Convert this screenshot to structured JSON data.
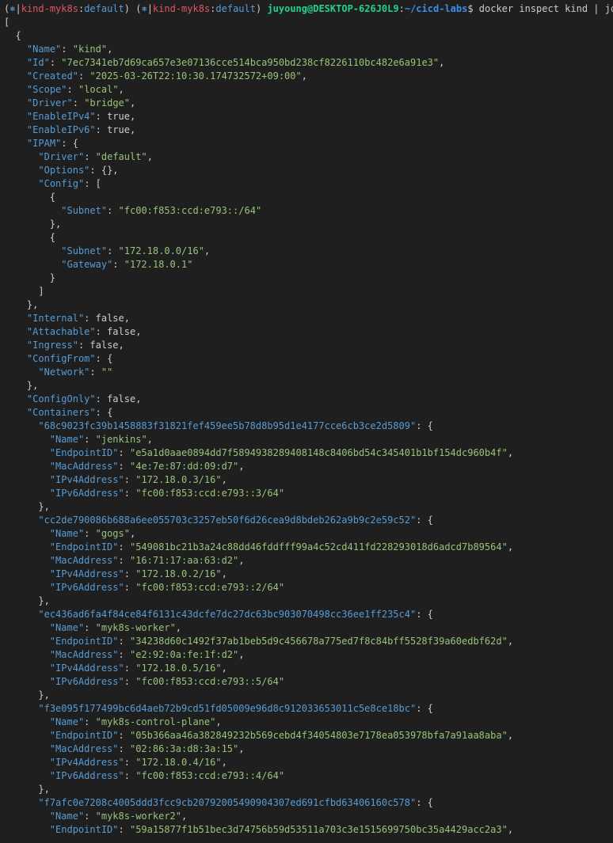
{
  "prompt": {
    "context_symbol": "⎈",
    "context_name": "kind-myk8s",
    "context_namespace": "default",
    "user_host": "juyoung@DESKTOP-626J0L9",
    "path": "~/cicd-labs",
    "command": "docker inspect kind | jq"
  },
  "output": [
    {
      "indent": 0,
      "text": "["
    },
    {
      "indent": 1,
      "text": "{"
    },
    {
      "indent": 2,
      "key": "Name",
      "str": "kind",
      "tail": ","
    },
    {
      "indent": 2,
      "key": "Id",
      "str": "7ec7341eb7d69ca657e3e07136cce514bca950bd238cf8226110bc482e6a91e3",
      "tail": ","
    },
    {
      "indent": 2,
      "key": "Created",
      "str": "2025-03-26T22:10:30.174732572+09:00",
      "tail": ","
    },
    {
      "indent": 2,
      "key": "Scope",
      "str": "local",
      "tail": ","
    },
    {
      "indent": 2,
      "key": "Driver",
      "str": "bridge",
      "tail": ","
    },
    {
      "indent": 2,
      "key": "EnableIPv4",
      "val": "true",
      "tail": ","
    },
    {
      "indent": 2,
      "key": "EnableIPv6",
      "val": "true",
      "tail": ","
    },
    {
      "indent": 2,
      "key": "IPAM",
      "val": "{"
    },
    {
      "indent": 3,
      "key": "Driver",
      "str": "default",
      "tail": ","
    },
    {
      "indent": 3,
      "key": "Options",
      "val": "{},"
    },
    {
      "indent": 3,
      "key": "Config",
      "val": "["
    },
    {
      "indent": 4,
      "text": "{"
    },
    {
      "indent": 5,
      "key": "Subnet",
      "str": "fc00:f853:ccd:e793::/64"
    },
    {
      "indent": 4,
      "text": "},"
    },
    {
      "indent": 4,
      "text": "{"
    },
    {
      "indent": 5,
      "key": "Subnet",
      "str": "172.18.0.0/16",
      "tail": ","
    },
    {
      "indent": 5,
      "key": "Gateway",
      "str": "172.18.0.1"
    },
    {
      "indent": 4,
      "text": "}"
    },
    {
      "indent": 3,
      "text": "]"
    },
    {
      "indent": 2,
      "text": "},"
    },
    {
      "indent": 2,
      "key": "Internal",
      "val": "false",
      "tail": ","
    },
    {
      "indent": 2,
      "key": "Attachable",
      "val": "false",
      "tail": ","
    },
    {
      "indent": 2,
      "key": "Ingress",
      "val": "false",
      "tail": ","
    },
    {
      "indent": 2,
      "key": "ConfigFrom",
      "val": "{"
    },
    {
      "indent": 3,
      "key": "Network",
      "str": ""
    },
    {
      "indent": 2,
      "text": "},"
    },
    {
      "indent": 2,
      "key": "ConfigOnly",
      "val": "false",
      "tail": ","
    },
    {
      "indent": 2,
      "key": "Containers",
      "val": "{"
    },
    {
      "indent": 3,
      "key": "68c9023fc39b1458883f31821fef459ee5b78d8b95d1e4177cce6cb3ce2d5809",
      "val": "{"
    },
    {
      "indent": 4,
      "key": "Name",
      "str": "jenkins",
      "tail": ","
    },
    {
      "indent": 4,
      "key": "EndpointID",
      "str": "e5a1d0aae0894dd7f5894938289408148c8406bd54c345401b1bf154dc960b4f",
      "tail": ","
    },
    {
      "indent": 4,
      "key": "MacAddress",
      "str": "4e:7e:87:dd:09:d7",
      "tail": ","
    },
    {
      "indent": 4,
      "key": "IPv4Address",
      "str": "172.18.0.3/16",
      "tail": ","
    },
    {
      "indent": 4,
      "key": "IPv6Address",
      "str": "fc00:f853:ccd:e793::3/64"
    },
    {
      "indent": 3,
      "text": "},"
    },
    {
      "indent": 3,
      "key": "cc2de790086b688a6ee055703c3257eb50f6d26cea9d8bdeb262a9b9c2e59c52",
      "val": "{"
    },
    {
      "indent": 4,
      "key": "Name",
      "str": "gogs",
      "tail": ","
    },
    {
      "indent": 4,
      "key": "EndpointID",
      "str": "549081bc21b3a24c88dd46fddfff99a4c52cd411fd228293018d6adcd7b89564",
      "tail": ","
    },
    {
      "indent": 4,
      "key": "MacAddress",
      "str": "16:71:17:aa:63:d2",
      "tail": ","
    },
    {
      "indent": 4,
      "key": "IPv4Address",
      "str": "172.18.0.2/16",
      "tail": ","
    },
    {
      "indent": 4,
      "key": "IPv6Address",
      "str": "fc00:f853:ccd:e793::2/64"
    },
    {
      "indent": 3,
      "text": "},"
    },
    {
      "indent": 3,
      "key": "ec436ad6fa4f84ce84f6131c43dcfe7dc27dc63bc903070498cc36ee1ff235c4",
      "val": "{"
    },
    {
      "indent": 4,
      "key": "Name",
      "str": "myk8s-worker",
      "tail": ","
    },
    {
      "indent": 4,
      "key": "EndpointID",
      "str": "34238d60c1492f37ab1beb5d9c456678a775ed7f8c84bff5528f39a60edbf62d",
      "tail": ","
    },
    {
      "indent": 4,
      "key": "MacAddress",
      "str": "e2:92:0a:fe:1f:d2",
      "tail": ","
    },
    {
      "indent": 4,
      "key": "IPv4Address",
      "str": "172.18.0.5/16",
      "tail": ","
    },
    {
      "indent": 4,
      "key": "IPv6Address",
      "str": "fc00:f853:ccd:e793::5/64"
    },
    {
      "indent": 3,
      "text": "},"
    },
    {
      "indent": 3,
      "key": "f3e095f177499bc6d4aeb72b9cd51fd05009e96d8c912033653011c5e8ce18bc",
      "val": "{"
    },
    {
      "indent": 4,
      "key": "Name",
      "str": "myk8s-control-plane",
      "tail": ","
    },
    {
      "indent": 4,
      "key": "EndpointID",
      "str": "05b366aa46a382849232b569cebd4f34054803e7178ea053978bfa7a91aa8aba",
      "tail": ","
    },
    {
      "indent": 4,
      "key": "MacAddress",
      "str": "02:86:3a:d8:3a:15",
      "tail": ","
    },
    {
      "indent": 4,
      "key": "IPv4Address",
      "str": "172.18.0.4/16",
      "tail": ","
    },
    {
      "indent": 4,
      "key": "IPv6Address",
      "str": "fc00:f853:ccd:e793::4/64"
    },
    {
      "indent": 3,
      "text": "},"
    },
    {
      "indent": 3,
      "key": "f7afc0e7208c4005ddd3fcc9cb20792005490904307ed691cfbd63406160c578",
      "val": "{"
    },
    {
      "indent": 4,
      "key": "Name",
      "str": "myk8s-worker2",
      "tail": ","
    },
    {
      "indent": 4,
      "key": "EndpointID",
      "str": "59a15877f1b51bec3d74756b59d53511a703c3e1515699750bc35a4429acc2a3",
      "tail": ","
    }
  ]
}
